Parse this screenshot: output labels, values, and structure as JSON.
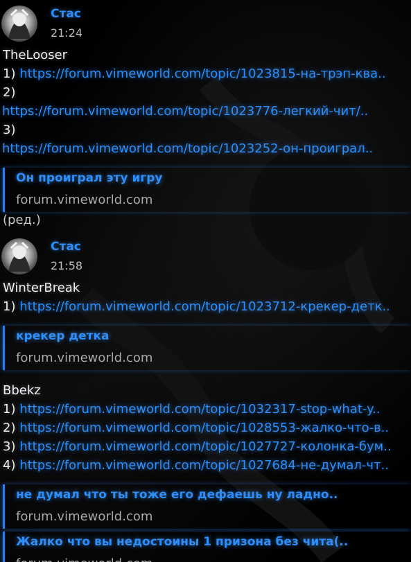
{
  "messages": [
    {
      "author": "Стас",
      "time": "21:24",
      "blocks": [
        {
          "nick": "TheLooser",
          "lines": [
            {
              "num": "1)",
              "url": "https://forum.vimeworld.com/topic/1023815-на-трэп-ква.."
            },
            {
              "num": "2)",
              "url": "https://forum.vimeworld.com/topic/1023776-легкий-чит/.."
            },
            {
              "num": "3)",
              "url": "https://forum.vimeworld.com/topic/1023252-он-проиграл.."
            }
          ],
          "previews": [
            {
              "title": "Он проиграл эту игру",
              "site": "forum.vimeworld.com"
            }
          ]
        }
      ],
      "edited": "(ред.)"
    },
    {
      "author": "Стас",
      "time": "21:58",
      "blocks": [
        {
          "nick": "WinterBreak",
          "lines": [
            {
              "num": "1)",
              "url": "https://forum.vimeworld.com/topic/1023712-крекер-детк.."
            }
          ],
          "previews": [
            {
              "title": "крекер детка",
              "site": "forum.vimeworld.com"
            }
          ]
        },
        {
          "nick": "Bbekz",
          "lines": [
            {
              "num": "1)",
              "url": "https://forum.vimeworld.com/topic/1032317-stop-what-y.."
            },
            {
              "num": "2)",
              "url": "https://forum.vimeworld.com/topic/1028553-жалко-что-в.."
            },
            {
              "num": "3)",
              "url": "https://forum.vimeworld.com/topic/1027727-колонка-бум.."
            },
            {
              "num": "4)",
              "url": "https://forum.vimeworld.com/topic/1027684-не-думал-чт.."
            }
          ],
          "previews": [
            {
              "title": "не думал что ты тоже его дефаешь ну ладно..",
              "site": "forum.vimeworld.com"
            },
            {
              "title": "Жалко что вы недостоины 1 призона без чита(..",
              "site": "forum.vimeworld.com"
            }
          ]
        }
      ]
    }
  ],
  "colors": {
    "link": "#2f8df5",
    "accent_bar": "#2f7de0",
    "text": "#e8e8e8",
    "muted": "#a9a9a9",
    "background": "#000000"
  }
}
